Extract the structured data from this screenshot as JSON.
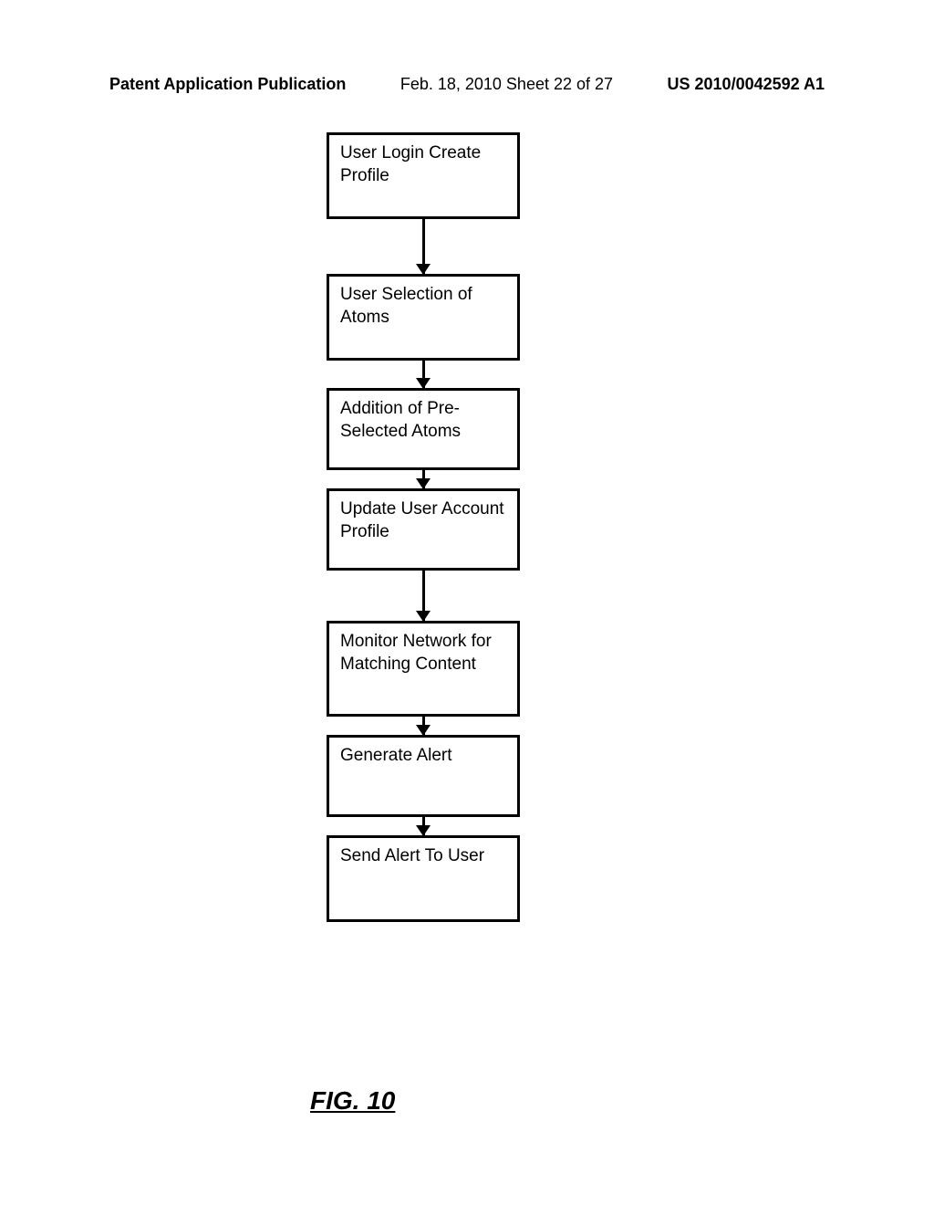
{
  "header": {
    "left": "Patent Application Publication",
    "center": "Feb. 18, 2010  Sheet 22 of 27",
    "right": "US 2010/0042592 A1"
  },
  "flowchart": {
    "boxes": [
      {
        "text": "User Login Create Profile"
      },
      {
        "text": "User Selection of Atoms"
      },
      {
        "text": "Addition of Pre-Selected Atoms"
      },
      {
        "text": "Update User Account Profile"
      },
      {
        "text": "Monitor Network for Matching Content"
      },
      {
        "text": "Generate Alert"
      },
      {
        "text": "Send Alert To User"
      }
    ]
  },
  "figure_label": "FIG. 10"
}
